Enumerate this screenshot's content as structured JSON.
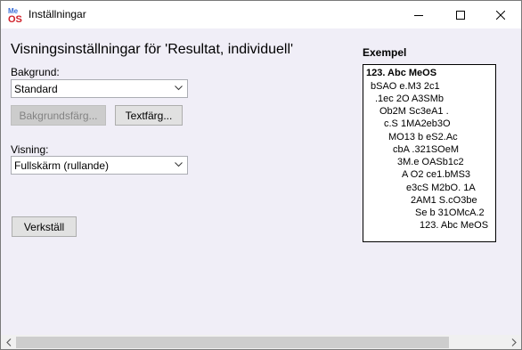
{
  "window": {
    "title": "Inställningar",
    "icon": "meos-app-icon"
  },
  "main": {
    "heading": "Visningsinställningar för 'Resultat, individuell'",
    "background": {
      "label": "Bakgrund:",
      "selected": "Standard"
    },
    "buttons": {
      "background_color": "Bakgrundsfärg...",
      "text_color": "Textfärg..."
    },
    "display": {
      "label": "Visning:",
      "selected": "Fullskärm (rullande)"
    },
    "apply": "Verkställ"
  },
  "example": {
    "label": "Exempel",
    "lines": [
      "123. Abc MeOS",
      "bSAO e.M3 2c1",
      ".1ec 2O A3SMb",
      "Ob2M Sc3eA1 .",
      "c.S  1MA2eb3O",
      "MO13 b eS2.Ac",
      "cbA .321SOeM",
      "3M.e OASb1c2",
      "A O2 ce1.bMS3",
      "e3cS M2bO. 1A",
      "2AM1  S.cO3be",
      "Se b 31OMcA.2",
      "123. Abc MeOS"
    ]
  },
  "colors": {
    "client_bg": "#f0eef7",
    "titlebar_bg": "#ffffff",
    "icon_red": "#d0202a",
    "icon_blue": "#3a6fd8"
  }
}
